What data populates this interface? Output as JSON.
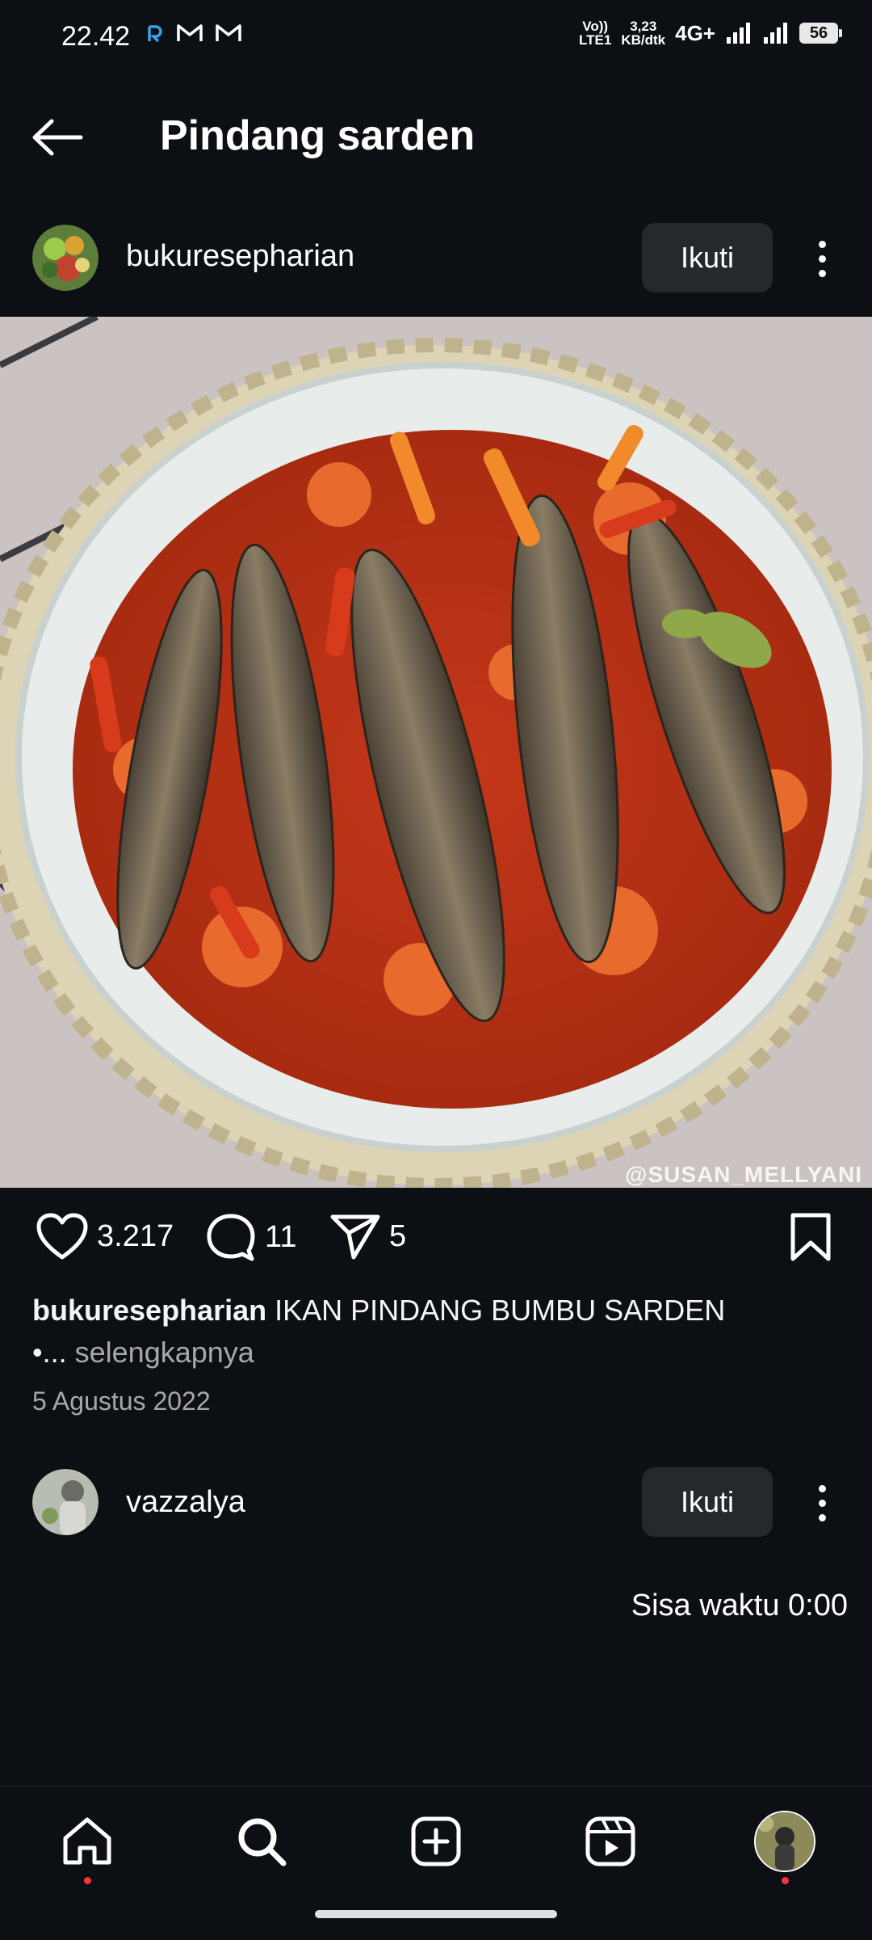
{
  "status_bar": {
    "time": "22.42",
    "volte_top": "Vo))",
    "volte_bottom": "LTE1",
    "speed_value": "3,23",
    "speed_unit": "KB/dtk",
    "network": "4G+",
    "battery": "56"
  },
  "header": {
    "title": "Pindang sarden"
  },
  "post": {
    "username": "bukuresepharian",
    "follow_label": "Ikuti",
    "likes": "3.217",
    "comments": "11",
    "shares": "5",
    "caption_user": "bukuresepharian",
    "caption_text": "IKAN PINDANG BUMBU SARDEN",
    "caption_prefix": "•...",
    "more_label": "selengkapnya",
    "date": "5 Agustus 2022",
    "watermark": "@SUSAN_MELLYANI"
  },
  "next_post": {
    "username": "vazzalya",
    "follow_label": "Ikuti"
  },
  "remaining_time": "Sisa waktu 0:00",
  "nav": {
    "items": [
      "home-icon",
      "search-icon",
      "create-icon",
      "reels-icon",
      "profile-avatar"
    ]
  },
  "colors": {
    "background": "#0c1014",
    "button": "#25292e",
    "notification_dot": "#ff3040",
    "secondary_text": "#a8a8a8"
  }
}
